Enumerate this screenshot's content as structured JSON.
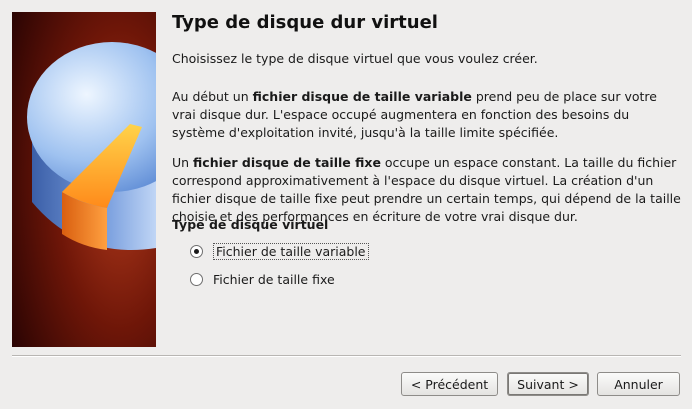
{
  "page": {
    "title": "Type de disque dur virtuel",
    "intro": "Choisissez le type de disque virtuel que vous voulez créer."
  },
  "variable_paragraph": {
    "before": "Au début un ",
    "bold": "fichier disque de taille variable",
    "after": " prend peu de place sur votre vrai disque dur. L'espace occupé augmentera en fonction des besoins du système d'exploitation invité, jusqu'à la taille limite spécifiée."
  },
  "fixed_paragraph": {
    "before": "Un ",
    "bold": "fichier disque de taille fixe",
    "after": " occupe un espace constant. La taille du fichier correspond approximativement à l'espace du disque virtuel. La création d'un fichier disque de taille fixe peut prendre un certain temps, qui dépend de la taille choisie et des performances en écriture de votre vrai disque dur."
  },
  "disk_type": {
    "label": "Type de disque virtuel",
    "options": [
      {
        "label": "Fichier de taille variable",
        "checked": true
      },
      {
        "label": "Fichier de taille fixe",
        "checked": false
      }
    ]
  },
  "buttons": {
    "previous": "< Précédent",
    "next": "Suivant >",
    "cancel": "Annuler"
  }
}
